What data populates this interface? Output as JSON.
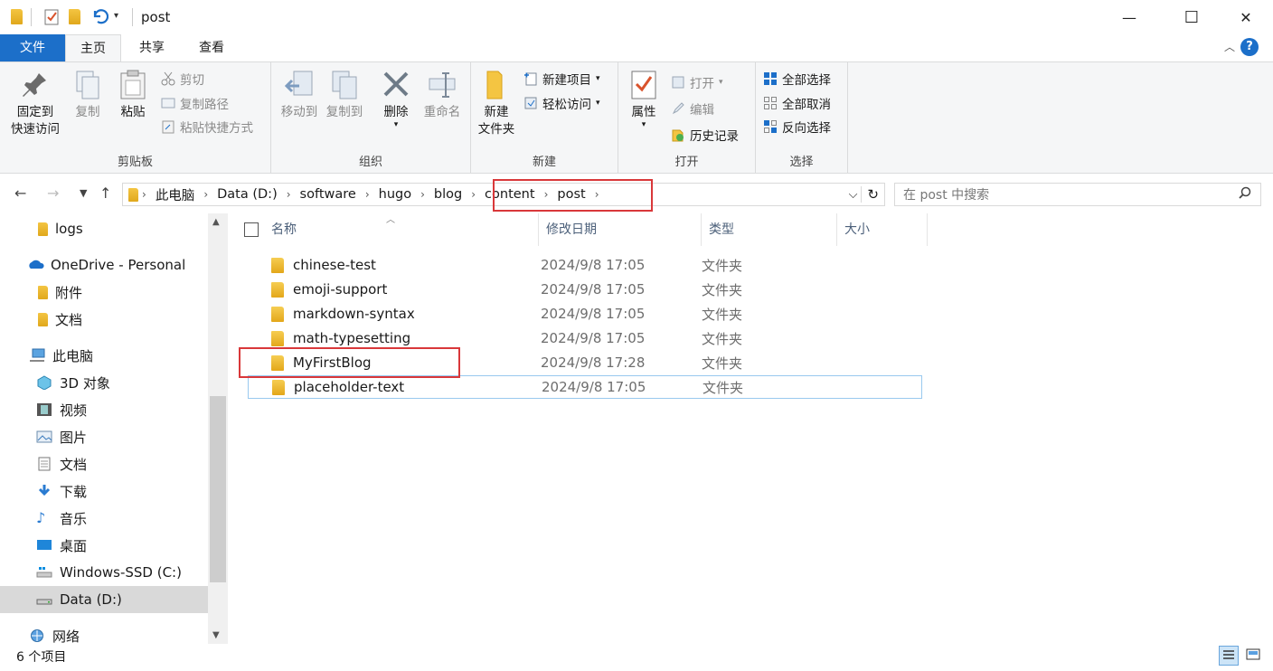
{
  "window": {
    "title": "post",
    "minimize": "—",
    "maximize": "☐",
    "close": "✕"
  },
  "tabs": [
    "文件",
    "主页",
    "共享",
    "查看"
  ],
  "ribbon": {
    "clipboard": {
      "label": "剪贴板",
      "pin_line1": "固定到",
      "pin_line2": "快速访问",
      "copy": "复制",
      "paste": "粘贴",
      "cut": "剪切",
      "copy_path": "复制路径",
      "paste_shortcut": "粘贴快捷方式"
    },
    "organize": {
      "label": "组织",
      "move_to": "移动到",
      "copy_to": "复制到",
      "delete": "删除",
      "rename": "重命名"
    },
    "new": {
      "label": "新建",
      "new_folder_line1": "新建",
      "new_folder_line2": "文件夹",
      "new_item": "新建项目",
      "easy_access": "轻松访问"
    },
    "open": {
      "label": "打开",
      "properties": "属性",
      "open": "打开",
      "edit": "编辑",
      "history": "历史记录"
    },
    "select": {
      "label": "选择",
      "select_all": "全部选择",
      "select_none": "全部取消",
      "invert": "反向选择"
    }
  },
  "address": {
    "crumbs": [
      "此电脑",
      "Data (D:)",
      "software",
      "hugo",
      "blog",
      "content",
      "post"
    ]
  },
  "search": {
    "placeholder": "在 post 中搜索"
  },
  "sidebar": {
    "items": [
      {
        "label": "logs",
        "icon": "folder-icon"
      },
      {
        "label": "OneDrive - Personal",
        "icon": "onedrive-icon"
      },
      {
        "label": "附件",
        "icon": "folder-icon"
      },
      {
        "label": "文档",
        "icon": "folder-icon"
      },
      {
        "label": "此电脑",
        "icon": "computer-icon"
      },
      {
        "label": "3D 对象",
        "icon": "cube-icon"
      },
      {
        "label": "视频",
        "icon": "film-icon"
      },
      {
        "label": "图片",
        "icon": "picture-icon"
      },
      {
        "label": "文档",
        "icon": "document-icon"
      },
      {
        "label": "下载",
        "icon": "download-icon"
      },
      {
        "label": "音乐",
        "icon": "music-icon"
      },
      {
        "label": "桌面",
        "icon": "desktop-icon"
      },
      {
        "label": "Windows-SSD (C:)",
        "icon": "drive-c-icon"
      },
      {
        "label": "Data (D:)",
        "icon": "drive-d-icon"
      },
      {
        "label": "网络",
        "icon": "network-icon"
      }
    ]
  },
  "columns": [
    "名称",
    "修改日期",
    "类型",
    "大小"
  ],
  "files": [
    {
      "name": "chinese-test",
      "date": "2024/9/8 17:05",
      "type": "文件夹"
    },
    {
      "name": "emoji-support",
      "date": "2024/9/8 17:05",
      "type": "文件夹"
    },
    {
      "name": "markdown-syntax",
      "date": "2024/9/8 17:05",
      "type": "文件夹"
    },
    {
      "name": "math-typesetting",
      "date": "2024/9/8 17:05",
      "type": "文件夹"
    },
    {
      "name": "MyFirstBlog",
      "date": "2024/9/8 17:28",
      "type": "文件夹"
    },
    {
      "name": "placeholder-text",
      "date": "2024/9/8 17:05",
      "type": "文件夹"
    }
  ],
  "status": {
    "count": "6 个项目"
  },
  "colors": {
    "accent": "#1c6fc9",
    "highlight": "#d9383a",
    "folder": "#f4c542"
  }
}
